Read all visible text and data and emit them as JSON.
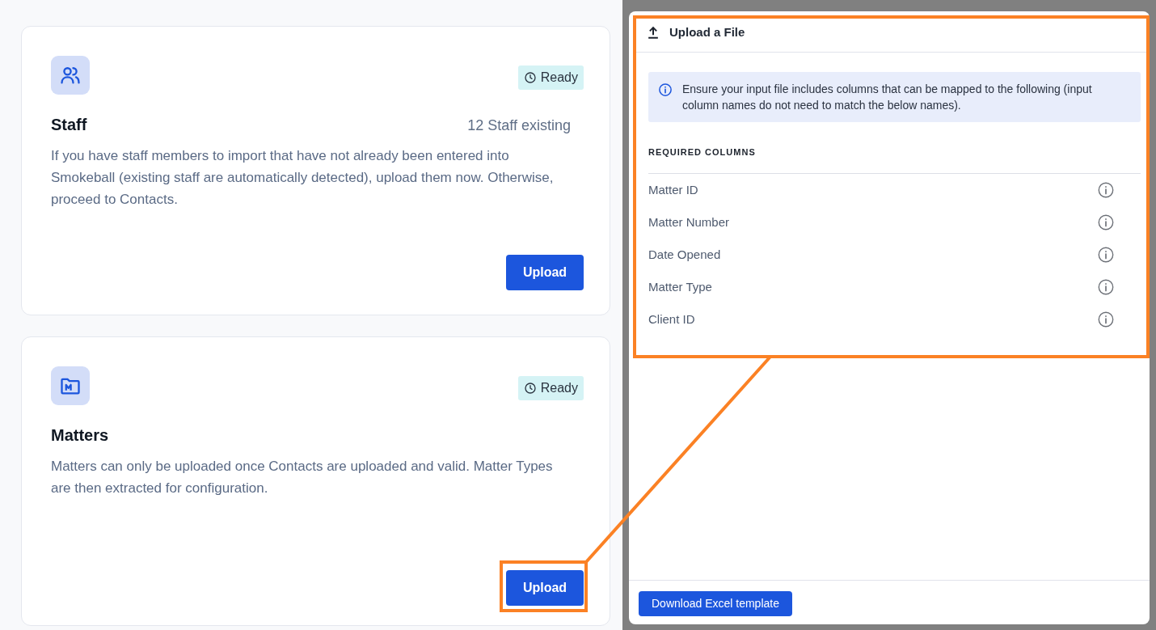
{
  "import_cards": [
    {
      "kind": "staff",
      "title": "Staff",
      "status": "Ready",
      "count": "12 Staff existing",
      "description": "If you have staff members to import that have not already been entered into Smokeball (existing staff are automatically detected), upload them now. Otherwise, proceed to Contacts.",
      "button": "Upload",
      "highlighted": false
    },
    {
      "kind": "matters",
      "title": "Matters",
      "status": "Ready",
      "description": "Matters can only be uploaded once Contacts are uploaded and valid. Matter Types are then extracted for configuration.",
      "button": "Upload",
      "highlighted": true
    }
  ],
  "upload_panel": {
    "title": "Upload a File",
    "highlighted": true,
    "notice": "Ensure your input file includes columns that can be mapped to the following (input column names do not need to match the below names).",
    "section_heading": "REQUIRED COLUMNS",
    "required_columns": [
      "Matter ID",
      "Matter Number",
      "Date Opened",
      "Matter Type",
      "Client ID"
    ],
    "button": "Download Excel template"
  }
}
